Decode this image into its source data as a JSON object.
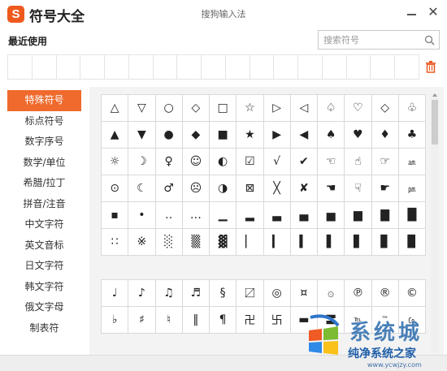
{
  "app": {
    "logo_letter": "S",
    "title": "符号大全",
    "window_title": "搜狗输入法",
    "close_glyph": "✕"
  },
  "recent": {
    "label": "最近使用",
    "cells": 17
  },
  "search": {
    "placeholder": "搜索符号"
  },
  "sidebar": {
    "items": [
      {
        "label": "特殊符号",
        "active": true
      },
      {
        "label": "标点符号"
      },
      {
        "label": "数字序号"
      },
      {
        "label": "数学/单位"
      },
      {
        "label": "希腊/拉丁"
      },
      {
        "label": "拼音/注音"
      },
      {
        "label": "中文字符"
      },
      {
        "label": "英文音标"
      },
      {
        "label": "日文字符"
      },
      {
        "label": "韩文字符"
      },
      {
        "label": "俄文字母"
      },
      {
        "label": "制表符"
      }
    ]
  },
  "grid1": [
    "△",
    "▽",
    "○",
    "◇",
    "□",
    "☆",
    "▷",
    "◁",
    "♤",
    "♡",
    "◇",
    "♧",
    "▲",
    "▼",
    "●",
    "◆",
    "■",
    "★",
    "▶",
    "◀",
    "♠",
    "♥",
    "♦",
    "♣",
    "☼",
    "☽",
    "♀",
    "☺",
    "◐",
    "☑",
    "√",
    "✔",
    "☜",
    "☝",
    "☞",
    "㏂",
    "⊙",
    "☾",
    "♂",
    "☹",
    "◑",
    "⊠",
    "╳",
    "✘",
    "☚",
    "☟",
    "☛",
    "㏘",
    "▪",
    "•",
    "‥",
    "…",
    "▁",
    "▂",
    "▃",
    "▄",
    "▅",
    "▆",
    "▇",
    "█",
    "∷",
    "※",
    "░",
    "▒",
    "▓",
    "▏",
    "▎",
    "▍",
    "▌",
    "▋",
    "▊",
    "▉"
  ],
  "grid2": [
    "♩",
    "♪",
    "♫",
    "♬",
    "§",
    "〼",
    "◎",
    "¤",
    "۞",
    "℗",
    "®",
    "©",
    "♭",
    "♯",
    "♮",
    "‖",
    "¶",
    "卍",
    "卐",
    "▬",
    "〓",
    "℡",
    "™",
    "㏇"
  ],
  "watermark": {
    "line1": "系统城",
    "line2": "纯净系统之家",
    "line3": "www.ycwjzy.com"
  },
  "colors": {
    "accent": "#ef6a2c",
    "logo": "#ee5a1e",
    "panel_bg": "#f3f3f3"
  }
}
